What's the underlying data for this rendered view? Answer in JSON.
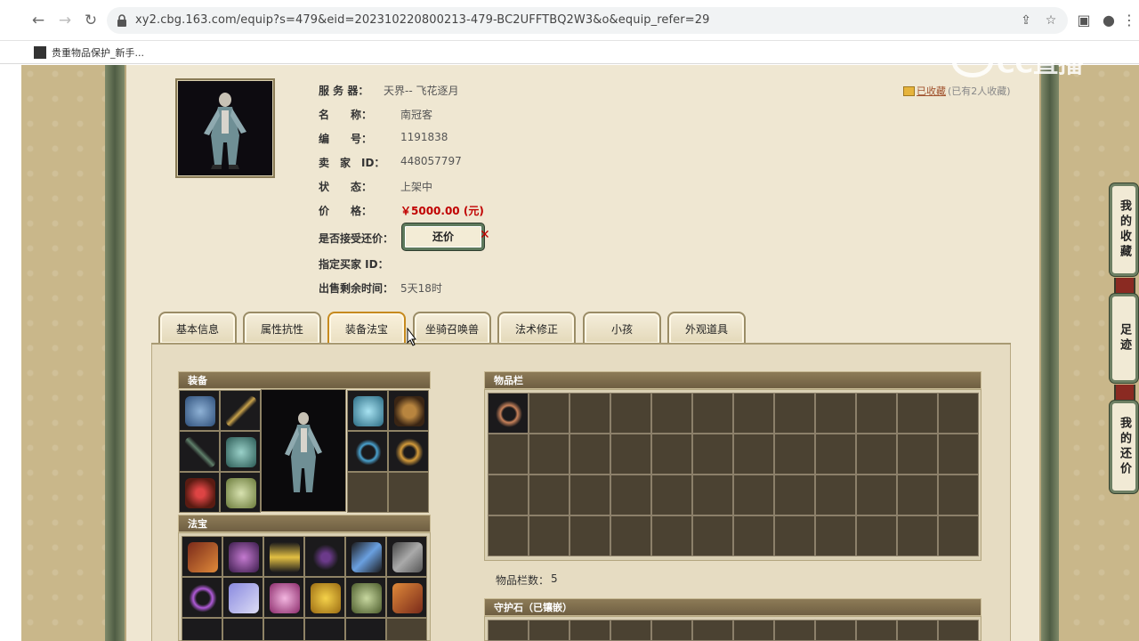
{
  "browser": {
    "url": "xy2.cbg.163.com/equip?s=479&eid=202310220800213-479-BC2UFFTBQ2W3&o&equip_refer=29",
    "bookmark_label": "贵重物品保护_新手..."
  },
  "watermark": "CC直播",
  "listing": {
    "fields": [
      {
        "label": "服 务 器：",
        "value": "天界-- 飞花逐月"
      },
      {
        "label": "名　　称：",
        "value": "南冠客"
      },
      {
        "label": "编　　号：",
        "value": "1191838"
      },
      {
        "label": "卖　家　ID：",
        "value": "448057797"
      },
      {
        "label": "状　　态：",
        "value": "上架中"
      },
      {
        "label": "价　　格：",
        "value": "￥5000.00 (元)"
      },
      {
        "label": "是否接受还价：",
        "value": ""
      },
      {
        "label": "指定买家 ID：",
        "value": ""
      },
      {
        "label": "出售剩余时间：",
        "value": "5天18时"
      }
    ],
    "counter_offer_label": "还价",
    "favorite_link": "已收藏",
    "favorite_count": "(已有2人收藏)"
  },
  "tabs": [
    {
      "label": "基本信息"
    },
    {
      "label": "属性抗性"
    },
    {
      "label": "装备法宝"
    },
    {
      "label": "坐骑召唤兽"
    },
    {
      "label": "法术修正"
    },
    {
      "label": "小孩"
    },
    {
      "label": "外观道具"
    }
  ],
  "active_tab": "装备法宝",
  "panels": {
    "equipment": "装备",
    "treasure": "法宝",
    "inventory": "物品栏",
    "inventory_count_label": "物品栏数：",
    "inventory_count": "5",
    "guard_stone": "守护石（已镶嵌）"
  },
  "side_buttons": [
    {
      "label": "我的收藏"
    },
    {
      "label": "足迹"
    },
    {
      "label": "我的还价"
    }
  ],
  "colors": {
    "price": "#c00000",
    "panel_bg": "#efe7d2",
    "slot_bg": "#4b4232",
    "frame_green": "#5e7a5d"
  }
}
